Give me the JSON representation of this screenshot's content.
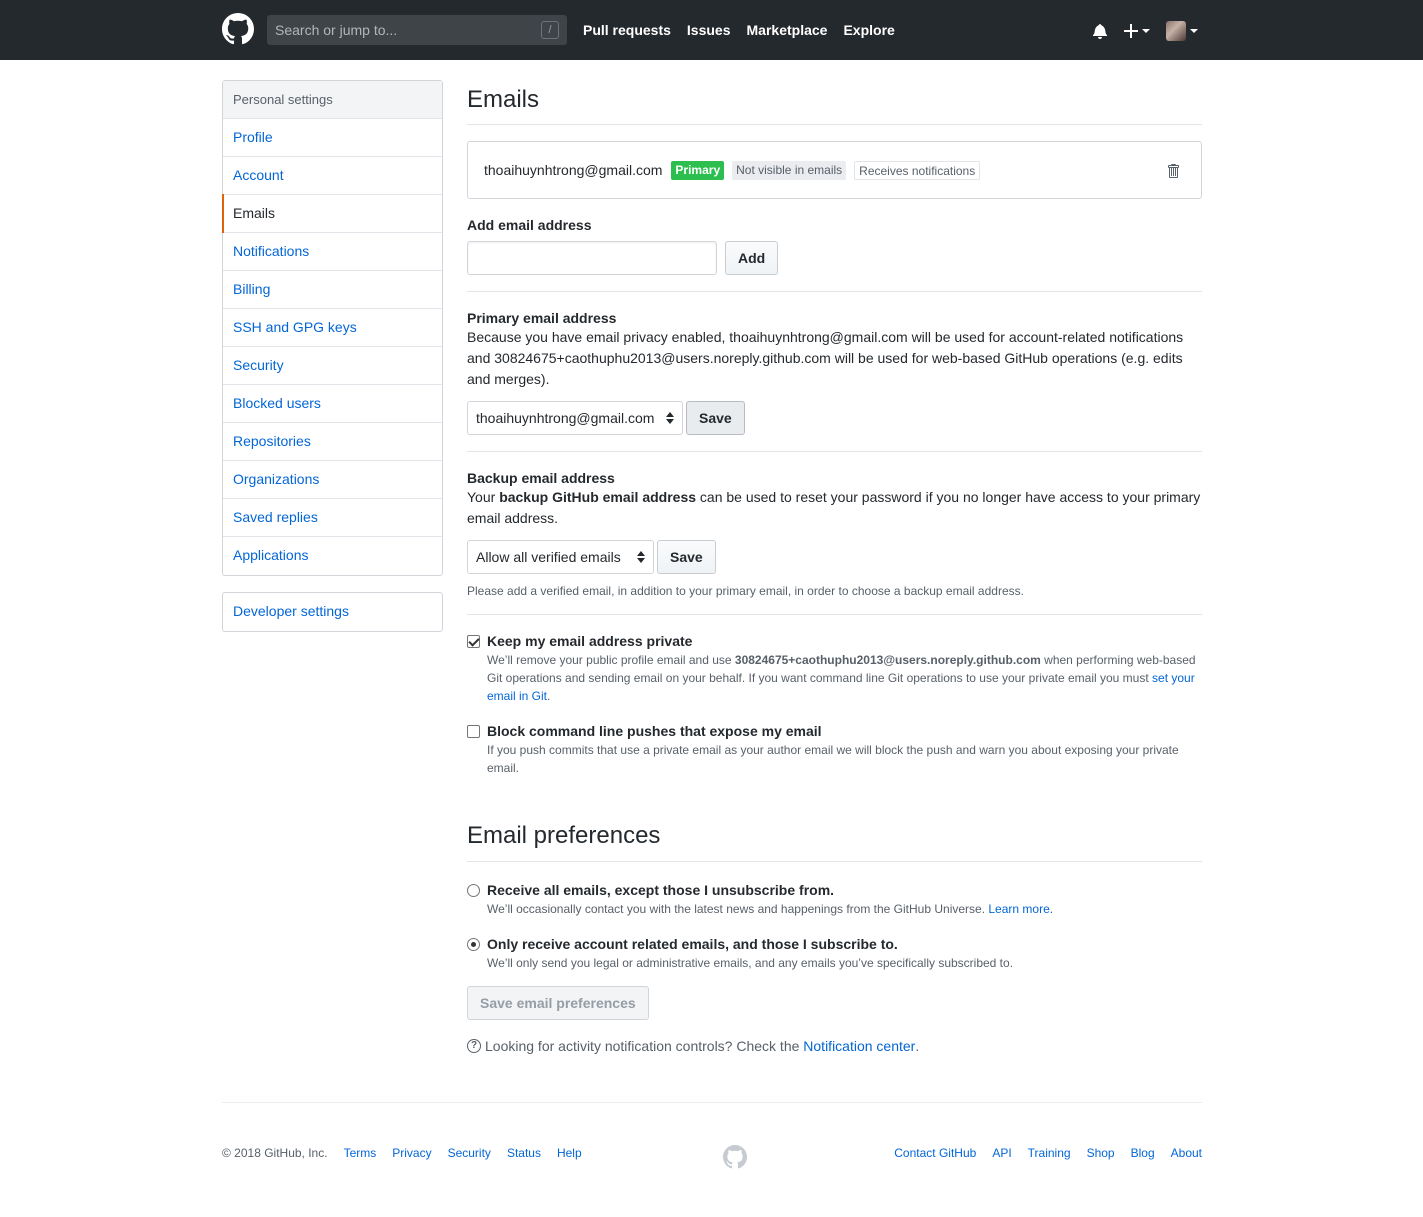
{
  "header": {
    "search_placeholder": "Search or jump to...",
    "slash_key": "/",
    "nav": [
      "Pull requests",
      "Issues",
      "Marketplace",
      "Explore"
    ],
    "icons": [
      "github-logo",
      "bell-icon",
      "plus-icon",
      "avatar"
    ]
  },
  "sidebar": {
    "heading": "Personal settings",
    "items": [
      "Profile",
      "Account",
      "Emails",
      "Notifications",
      "Billing",
      "SSH and GPG keys",
      "Security",
      "Blocked users",
      "Repositories",
      "Organizations",
      "Saved replies",
      "Applications"
    ],
    "selected": "Emails",
    "developer": "Developer settings"
  },
  "emails": {
    "title": "Emails",
    "entry": {
      "address": "thoaihuynhtrong@gmail.com",
      "badges": [
        "Primary",
        "Not visible in emails",
        "Receives notifications"
      ]
    },
    "add": {
      "label": "Add email address",
      "button": "Add"
    },
    "primary": {
      "label": "Primary email address",
      "description": "Because you have email privacy enabled, thoaihuynhtrong@gmail.com will be used for account-related notifications and 30824675+caothuphu2013@users.noreply.github.com will be used for web-based GitHub operations (e.g. edits and merges).",
      "selected": "thoaihuynhtrong@gmail.com",
      "button": "Save"
    },
    "backup": {
      "label": "Backup email address",
      "desc_pre": "Your ",
      "desc_bold": "backup GitHub email address",
      "desc_post": " can be used to reset your password if you no longer have access to your primary email address.",
      "selected": "Allow all verified emails",
      "button": "Save",
      "note": "Please add a verified email, in addition to your primary email, in order to choose a backup email address."
    },
    "keep_private": {
      "checked": true,
      "title": "Keep my email address private",
      "note_pre": "We’ll remove your public profile email and use ",
      "note_bold": "30824675+caothuphu2013@users.noreply.github.com",
      "note_mid": " when performing web-based Git operations and sending email on your behalf. If you want command line Git operations to use your private email you must ",
      "note_link": "set your email in Git",
      "note_post": "."
    },
    "block_pushes": {
      "checked": false,
      "title": "Block command line pushes that expose my email",
      "note": "If you push commits that use a private email as your author email we will block the push and warn you about exposing your private email."
    }
  },
  "preferences": {
    "title": "Email preferences",
    "options": [
      {
        "title": "Receive all emails, except those I unsubscribe from.",
        "note": "We’ll occasionally contact you with the latest news and happenings from the GitHub Universe. ",
        "link": "Learn more.",
        "selected": false
      },
      {
        "title": "Only receive account related emails, and those I subscribe to.",
        "note": "We’ll only send you legal or administrative emails, and any emails you’ve specifically subscribed to.",
        "link": "",
        "selected": true
      }
    ],
    "save_button": "Save email preferences",
    "help_text": "Looking for activity notification controls? Check the ",
    "help_link": "Notification center",
    "help_end": "."
  },
  "footer": {
    "copyright": "© 2018 GitHub, Inc.",
    "left_links": [
      "Terms",
      "Privacy",
      "Security",
      "Status",
      "Help"
    ],
    "right_links": [
      "Contact GitHub",
      "API",
      "Training",
      "Shop",
      "Blog",
      "About"
    ]
  },
  "colors": {
    "header_bg": "#24292e",
    "link": "#0366d6",
    "primary_badge": "#2cbe4e",
    "selected_accent": "#e36209"
  }
}
